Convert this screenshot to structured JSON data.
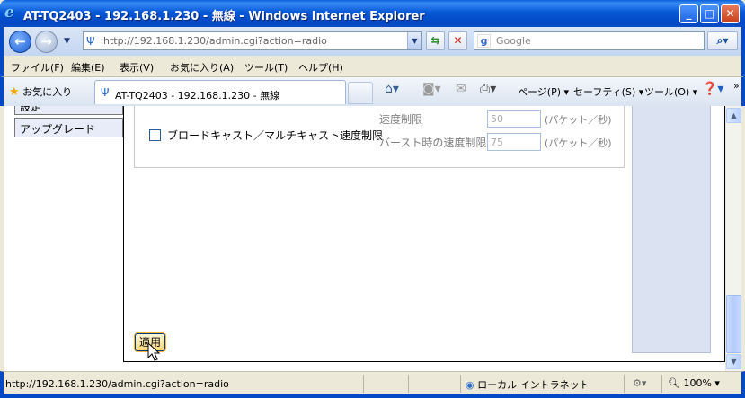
{
  "window": {
    "title": "AT-TQ2403 - 192.168.1.230 - 無線 - Windows Internet Explorer",
    "min_symbol": "_",
    "max_symbol": "□",
    "close_symbol": "✕"
  },
  "address": {
    "url": "http://192.168.1.230/admin.cgi?action=radio",
    "search_placeholder": "Google"
  },
  "menu": [
    "ファイル(F)",
    "編集(E)",
    "表示(V)",
    "お気に入り(A)",
    "ツール(T)",
    "ヘルプ(H)"
  ],
  "toolbar": {
    "favorites": "お気に入り",
    "tab_title": "AT-TQ2403 - 192.168.1.230 - 無線",
    "page": "ページ(P)",
    "safety": "セーフティ(S)",
    "tools": "ツール(O)"
  },
  "sidebar": {
    "items": [
      {
        "label": "設定"
      },
      {
        "label": "アップグレード"
      }
    ]
  },
  "form": {
    "broadcast_limit_label": "ブロードキャスト／マルチキャスト速度制限",
    "broadcast_limit_checked": false,
    "rate_limit_label": "速度制限",
    "rate_limit_value": "50",
    "burst_label": "バースト時の速度制限",
    "burst_value": "75",
    "unit": "(パケット／秒)",
    "apply_label": "適用"
  },
  "status": {
    "url": "http://192.168.1.230/admin.cgi?action=radio",
    "zone": "ローカル イントラネット",
    "zoom": "100%"
  },
  "colors": {
    "titlebar": "#0a5fd9",
    "sidebar_nav": "#e8ecf8",
    "side_panel": "#dbe2f2"
  }
}
